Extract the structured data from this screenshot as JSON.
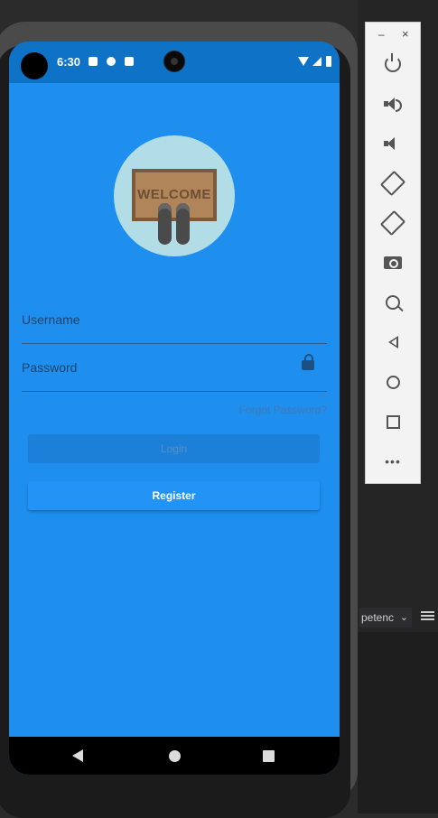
{
  "status_bar": {
    "time": "6:30"
  },
  "login_screen": {
    "logo_text": "WELCOME",
    "username_label": "Username",
    "password_label": "Password",
    "forgot_password": "Forgot Password?",
    "login_button": "Login",
    "register_button": "Register"
  },
  "emulator_toolbar": {
    "minimize": "–",
    "close": "×",
    "more": "•••"
  },
  "ide": {
    "tab_text": "petenc"
  },
  "colors": {
    "screen_background": "#1f8fef",
    "status_bar": "#0e72c7",
    "register_button": "#2394f6"
  },
  "icons": {
    "power": "power-icon",
    "volume_up": "volume-up-icon",
    "volume_down": "volume-down-icon",
    "rotate_left": "rotate-left-icon",
    "rotate_right": "rotate-right-icon",
    "screenshot": "camera-icon",
    "zoom": "zoom-icon",
    "back": "back-icon",
    "home": "home-icon",
    "overview": "overview-icon",
    "lock": "lock-icon"
  }
}
